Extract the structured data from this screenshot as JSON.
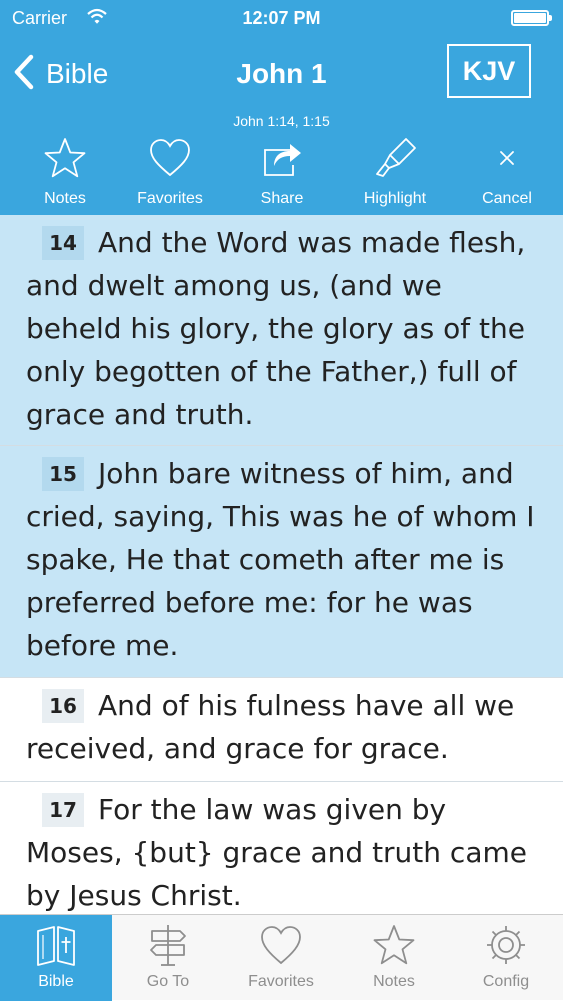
{
  "status_bar": {
    "carrier": "Carrier",
    "time": "12:07 PM"
  },
  "nav": {
    "back_label": "Bible",
    "title": "John 1",
    "version": "KJV"
  },
  "selection_ref": "John 1:14, 1:15",
  "toolbar": {
    "notes": "Notes",
    "favorites": "Favorites",
    "share": "Share",
    "highlight": "Highlight",
    "cancel": "Cancel"
  },
  "verses": [
    {
      "num": "14",
      "text": "And the Word was made flesh, and dwelt among us, (and we beheld his glory, the glory as of the only begotten of the Father,) full of grace and truth.",
      "selected": true
    },
    {
      "num": "15",
      "text": "John bare witness of him, and cried, saying, This was he of whom I spake, He that cometh after me is preferred before me: for he was before me.",
      "selected": true
    },
    {
      "num": "16",
      "text": "And of his fulness have all we received, and grace for grace.",
      "selected": false
    },
    {
      "num": "17",
      "text": "For the law was given by Moses, {but} grace and truth came by Jesus Christ.",
      "selected": false
    }
  ],
  "tabbar": {
    "bible": "Bible",
    "goto": "Go To",
    "favorites": "Favorites",
    "notes": "Notes",
    "config": "Config",
    "active": "bible"
  },
  "colors": {
    "accent": "#3aa6de",
    "selected_verse_bg": "#c6e5f6",
    "verse_number_bg": "#e8eef2",
    "inactive_tab": "#8e8e8e"
  }
}
